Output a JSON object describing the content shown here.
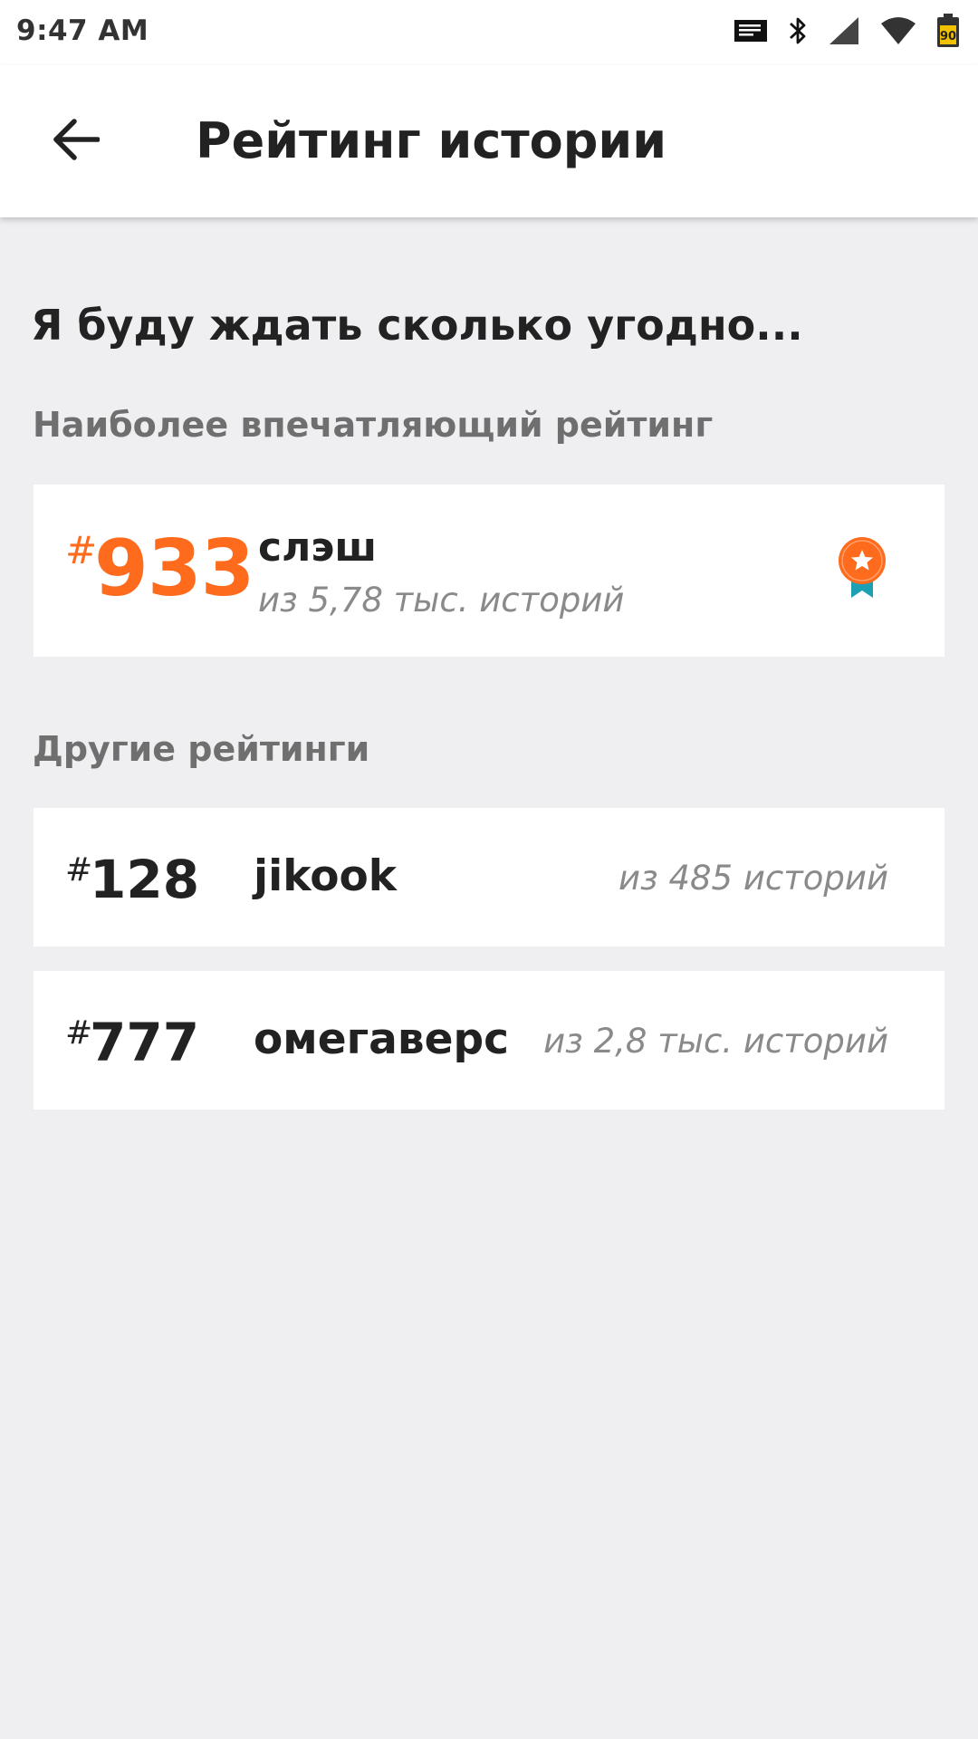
{
  "status_bar": {
    "time": "9:47 AM",
    "battery_level": "90"
  },
  "app_bar": {
    "title": "Рейтинг истории"
  },
  "story": {
    "title": "Я буду ждать сколько угодно..."
  },
  "featured": {
    "section_label": "Наиболее впечатляющий рейтинг",
    "hash": "#",
    "rank": "933",
    "tag": "слэш",
    "of_text": "из 5,78 тыс. историй"
  },
  "others": {
    "section_label": "Другие рейтинги",
    "items": [
      {
        "hash": "#",
        "rank": "128",
        "tag": "jikook",
        "of_text": "из 485 историй"
      },
      {
        "hash": "#",
        "rank": "777",
        "tag": "омегаверс",
        "of_text": "из 2,8 тыс. историй"
      }
    ]
  },
  "colors": {
    "accent": "#ff6b1c",
    "ribbon": "#1ea0b4",
    "background": "#efeef1",
    "card": "#ffffff",
    "muted_text": "#8a8a8a",
    "label_text": "#6f6f6f"
  }
}
